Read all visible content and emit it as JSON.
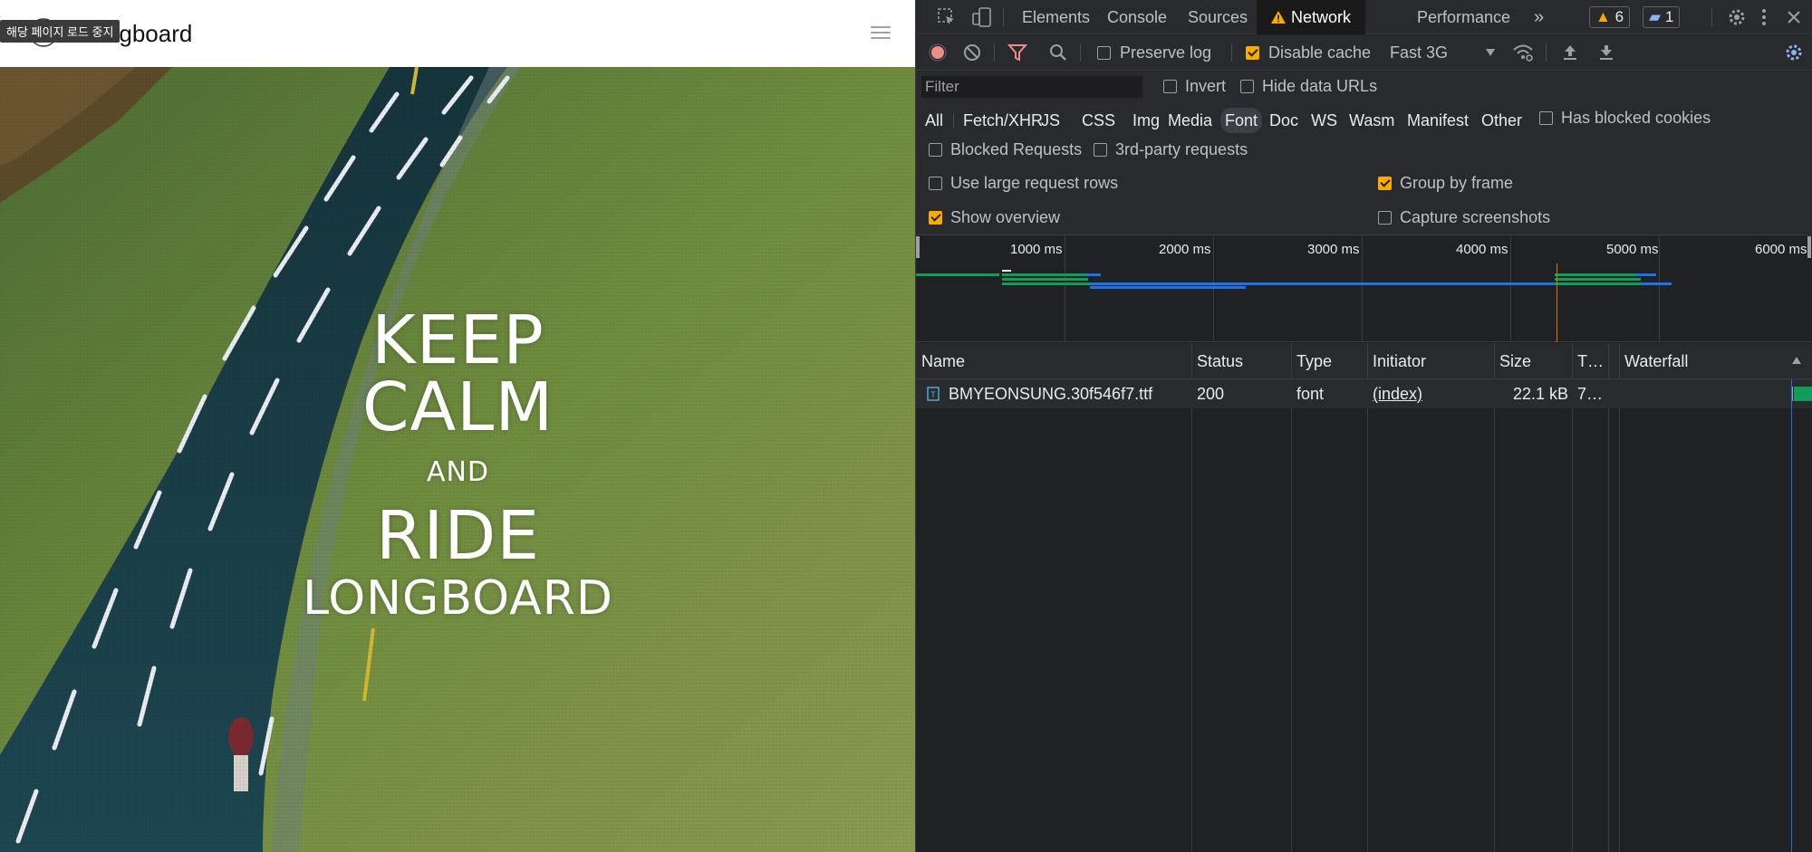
{
  "page": {
    "tooltip": "해당 페이지 로드 중지",
    "brand": "Longboard",
    "hero": {
      "line1": "KEEP",
      "line2": "CALM",
      "line3": "AND",
      "line4": "RIDE",
      "line5": "LONGBOARD"
    }
  },
  "devtools": {
    "tabs": [
      "Elements",
      "Console",
      "Sources",
      "Network",
      "Performance"
    ],
    "active_tab": "Network",
    "warnings_count": "6",
    "messages_count": "1",
    "toolbar": {
      "preserve_log": "Preserve log",
      "preserve_log_checked": false,
      "disable_cache": "Disable cache",
      "disable_cache_checked": true,
      "throttling": "Fast 3G"
    },
    "filter": {
      "placeholder": "Filter",
      "invert": "Invert",
      "hide_data_urls": "Hide data URLs",
      "types": [
        "All",
        "Fetch/XHR",
        "JS",
        "CSS",
        "Img",
        "Media",
        "Font",
        "Doc",
        "WS",
        "Wasm",
        "Manifest",
        "Other"
      ],
      "selected_type": "Font",
      "has_blocked_cookies": "Has blocked cookies",
      "blocked_requests": "Blocked Requests",
      "third_party": "3rd-party requests"
    },
    "options": {
      "large_rows": "Use large request rows",
      "group_by_frame": "Group by frame",
      "group_by_frame_checked": true,
      "show_overview": "Show overview",
      "show_overview_checked": true,
      "capture_screenshots": "Capture screenshots"
    },
    "overview_ticks": [
      "1000 ms",
      "2000 ms",
      "3000 ms",
      "4000 ms",
      "5000 ms",
      "6000 ms"
    ],
    "columns": [
      "Name",
      "Status",
      "Type",
      "Initiator",
      "Size",
      "T…",
      "Waterfall"
    ],
    "rows": [
      {
        "name": "BMYEONSUNG.30f546f7.ttf",
        "status": "200",
        "type": "font",
        "initiator": "(index)",
        "size": "22.1 kB",
        "time": "7…"
      }
    ],
    "colors": {
      "accent_orange": "#f9ab00",
      "record_red": "#f28b82",
      "filter_red": "#f28b82",
      "bar_green": "#0f9d58",
      "bar_blue": "#1a73e8",
      "settings_blue": "#8ab4f8"
    }
  }
}
